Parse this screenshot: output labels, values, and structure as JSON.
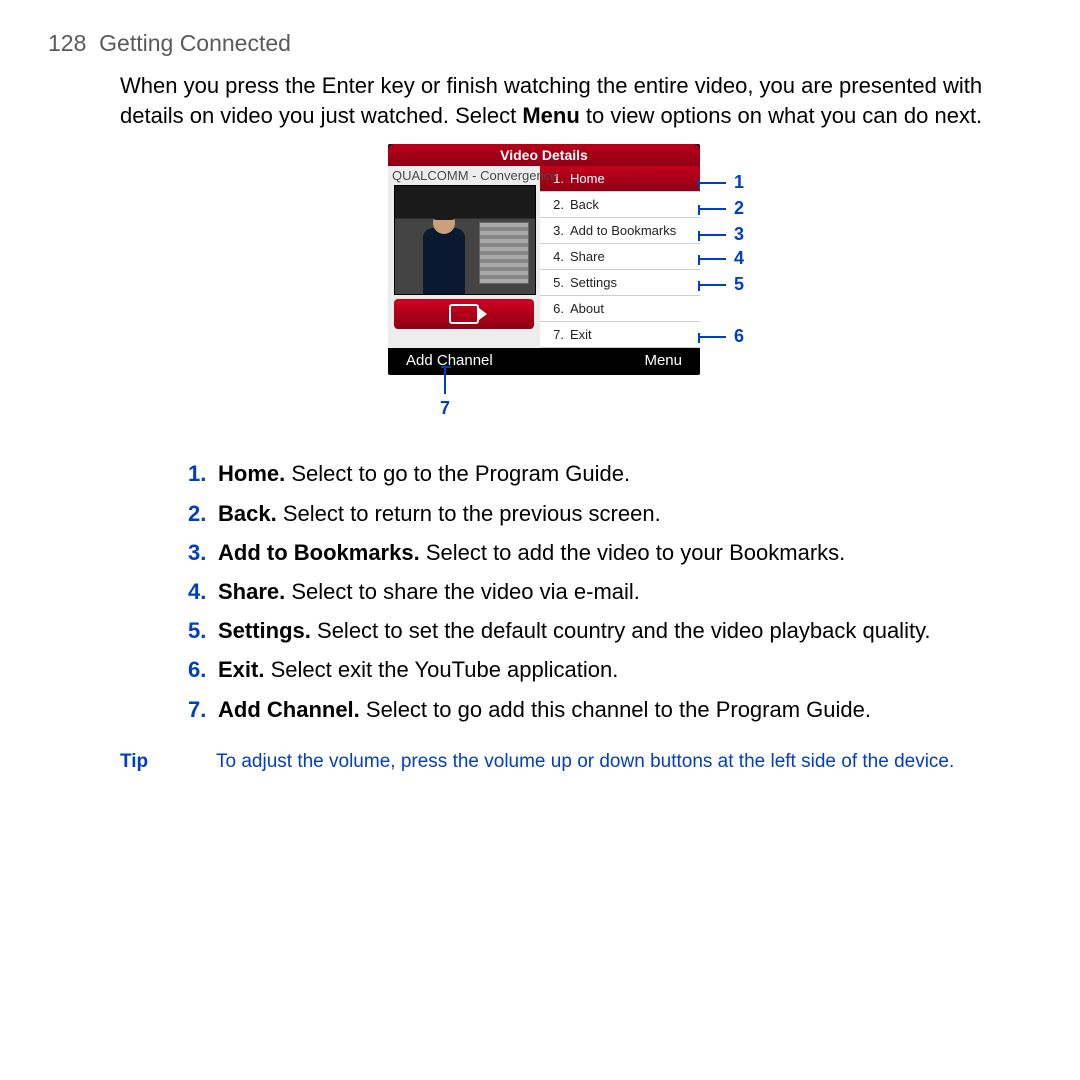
{
  "header": {
    "page_number": "128",
    "title": "Getting Connected"
  },
  "intro": {
    "pre": "When you press the Enter key or finish watching the entire video, you are presented with details on video you just watched. Select ",
    "bold": "Menu",
    "post": " to view options on what you can do next."
  },
  "phone": {
    "title": "Video Details",
    "video_label": "QUALCOMM - Convergence",
    "soft_left": "Add Channel",
    "soft_right": "Menu",
    "menu": [
      {
        "n": "1.",
        "label": "Home"
      },
      {
        "n": "2.",
        "label": "Back"
      },
      {
        "n": "3.",
        "label": "Add to Bookmarks"
      },
      {
        "n": "4.",
        "label": "Share"
      },
      {
        "n": "5.",
        "label": "Settings"
      },
      {
        "n": "6.",
        "label": "About"
      },
      {
        "n": "7.",
        "label": "Exit"
      }
    ]
  },
  "callouts": {
    "c1": "1",
    "c2": "2",
    "c3": "3",
    "c4": "4",
    "c5": "5",
    "c6": "6",
    "c7": "7"
  },
  "list": [
    {
      "n": "1.",
      "term": "Home.",
      "desc": " Select to go to the Program Guide."
    },
    {
      "n": "2.",
      "term": "Back.",
      "desc": " Select to return to the previous screen."
    },
    {
      "n": "3.",
      "term": "Add to Bookmarks.",
      "desc": " Select to add the video to your Bookmarks."
    },
    {
      "n": "4.",
      "term": "Share.",
      "desc": " Select to share the video via e-mail."
    },
    {
      "n": "5.",
      "term": "Settings.",
      "desc": " Select to set the default country and the video playback quality."
    },
    {
      "n": "6.",
      "term": "Exit.",
      "desc": " Select exit the YouTube application."
    },
    {
      "n": "7.",
      "term": "Add Channel.",
      "desc": " Select to go add this channel to the Program Guide."
    }
  ],
  "tip": {
    "label": "Tip",
    "text": "To adjust the volume, press the volume up or down buttons at the left side of the device."
  }
}
